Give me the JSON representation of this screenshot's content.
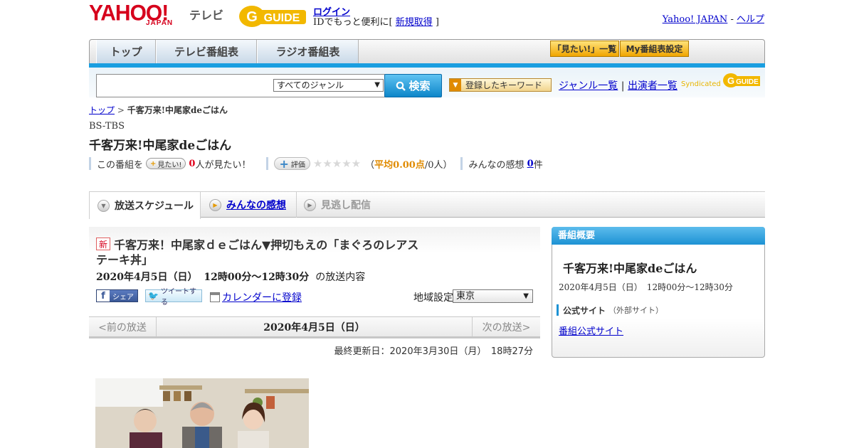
{
  "header": {
    "logo_yahoo": "YAHOO!",
    "logo_japan": "JAPAN",
    "logo_tv": "テレビ",
    "gguide": "G-GUIDE",
    "login": "ログイン",
    "id_text_pre": "IDでもっと便利に[ ",
    "signup": "新規取得",
    "id_text_post": " ]",
    "yahoo_japan": "Yahoo! JAPAN",
    "sep": " - ",
    "help": "ヘルプ"
  },
  "nav": {
    "tabs": [
      "トップ",
      "テレビ番組表",
      "ラジオ番組表"
    ],
    "mitai_list": "「見たい!」一覧",
    "my_schedule": "My番組表設定"
  },
  "search": {
    "placeholder": "",
    "genre": "すべてのジャンル",
    "button": "検索",
    "keyword_btn": "登録したキーワード",
    "genre_list": "ジャンル一覧",
    "divider": "|",
    "performer_list": "出演者一覧",
    "syndicated": "Syndicated"
  },
  "breadcrumb": {
    "top": "トップ",
    "sep": " > ",
    "current": "千客万来!中尾家deごはん"
  },
  "program": {
    "channel": "BS-TBS",
    "title": "千客万来!中尾家deごはん",
    "stats": {
      "prefix": "この番組を",
      "mitai_btn": "見たい!",
      "mitai_count": "0",
      "mitai_suffix": "人が見たい！",
      "rate_btn": "評価",
      "stars": "★★★★★",
      "avg_pre": "（",
      "avg": "平均0.00点",
      "avg_post": "/0人）",
      "review_label": "みんなの感想",
      "review_count": "0",
      "review_suffix": "件"
    }
  },
  "tabs": {
    "schedule": "放送スケジュール",
    "reviews": "みんなの感想",
    "vod": "見逃し配信"
  },
  "episode": {
    "new_badge": "新",
    "title": "千客万来！中尾家ｄｅごはん▼押切もえの「まぐろのレアステーキ丼」",
    "date": "2020年4月5日（日）",
    "time": "12時00分～12時30分",
    "suffix": "の放送内容",
    "share_fb": "シェア",
    "share_tw": "ツイートする",
    "calendar": "カレンダーに登録",
    "region_label": "地域設定",
    "region": "東京"
  },
  "datenav": {
    "prev": "<前の放送",
    "current": "2020年4月5日（日）",
    "next": "次の放送>"
  },
  "updated": "最終更新日：2020年3月30日（月）　18時27分",
  "sidebar": {
    "head": "番組概要",
    "title": "千客万来!中尾家deごはん",
    "date": "2020年4月5日（日）　12時00分～12時30分",
    "section": "公式サイト",
    "section_sub": "（外部サイト）",
    "link": "番組公式サイト"
  },
  "colors": {
    "accent_blue": "#1d92d4",
    "yahoo_red": "#d6001c",
    "gguide_yellow": "#f2b800"
  }
}
